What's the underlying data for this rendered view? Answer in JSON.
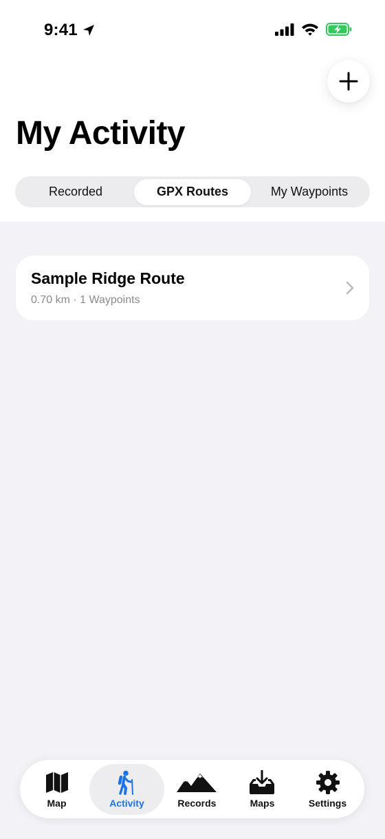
{
  "status_bar": {
    "time": "9:41"
  },
  "header": {
    "title": "My Activity"
  },
  "segments": [
    {
      "label": "Recorded",
      "active": false
    },
    {
      "label": "GPX Routes",
      "active": true
    },
    {
      "label": "My Waypoints",
      "active": false
    }
  ],
  "routes": [
    {
      "name": "Sample Ridge Route",
      "meta": "0.70 km · 1 Waypoints"
    }
  ],
  "tabs": [
    {
      "label": "Map",
      "icon": "map-icon",
      "active": false
    },
    {
      "label": "Activity",
      "icon": "hiker-icon",
      "active": true
    },
    {
      "label": "Records",
      "icon": "mountains-icon",
      "active": false
    },
    {
      "label": "Maps",
      "icon": "tray-download-icon",
      "active": false
    },
    {
      "label": "Settings",
      "icon": "gear-icon",
      "active": false
    }
  ],
  "colors": {
    "accent": "#1a73e8",
    "battery_green": "#34c759",
    "content_background": "#f2f2f7",
    "segment_background": "#ececee",
    "secondary_text": "#8a8a8e"
  }
}
